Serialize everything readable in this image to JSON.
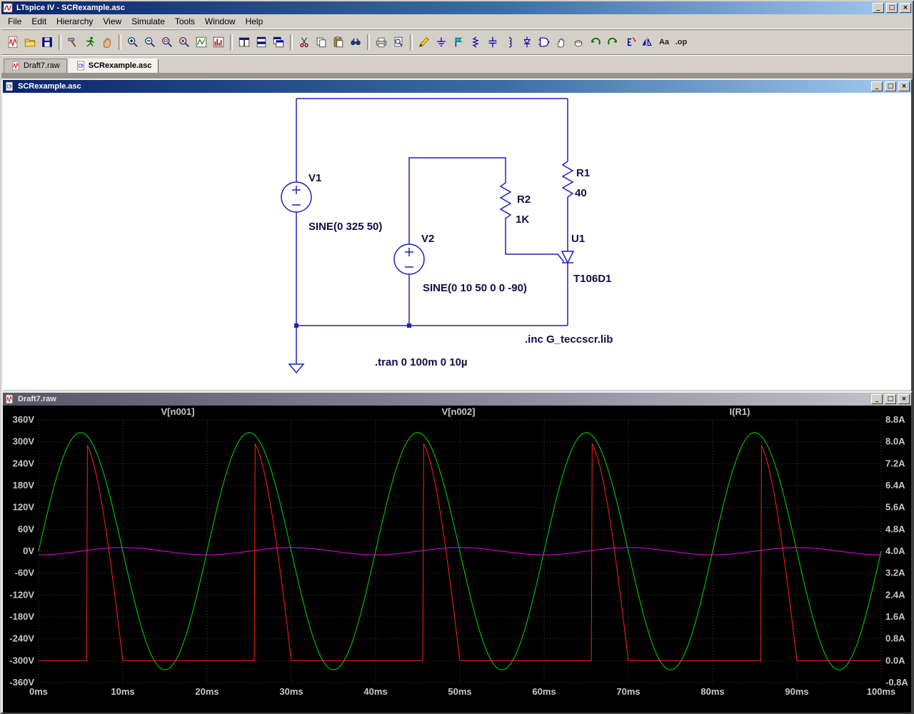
{
  "window": {
    "title": "LTspice IV - SCRexample.asc",
    "controls": {
      "minimize": "_",
      "restore": "□",
      "close": "×"
    }
  },
  "menu": {
    "items": [
      "File",
      "Edit",
      "Hierarchy",
      "View",
      "Simulate",
      "Tools",
      "Window",
      "Help"
    ]
  },
  "toolbar": {
    "buttons": [
      {
        "name": "new-schematic",
        "icon": "doc-wave"
      },
      {
        "name": "open-file",
        "icon": "folder"
      },
      {
        "name": "save",
        "icon": "save"
      },
      {
        "sep": true
      },
      {
        "name": "control-panel",
        "icon": "hammer"
      },
      {
        "name": "run-simulation",
        "icon": "run"
      },
      {
        "name": "halt-simulation",
        "icon": "halt"
      },
      {
        "sep": true
      },
      {
        "name": "zoom-in",
        "icon": "zoom-in"
      },
      {
        "name": "zoom-out",
        "icon": "zoom-out"
      },
      {
        "name": "zoom-area",
        "icon": "zoom-area"
      },
      {
        "name": "zoom-full-extents",
        "icon": "zoom-extents"
      },
      {
        "name": "autorange-y",
        "icon": "plot-line"
      },
      {
        "name": "fft",
        "icon": "plot-bars"
      },
      {
        "sep": true
      },
      {
        "name": "tile-vertically",
        "icon": "tile-v"
      },
      {
        "name": "tile-horizontally",
        "icon": "tile-h"
      },
      {
        "name": "cascade-windows",
        "icon": "cascade"
      },
      {
        "sep": true
      },
      {
        "name": "cut",
        "icon": "cut"
      },
      {
        "name": "copy",
        "icon": "copy"
      },
      {
        "name": "paste",
        "icon": "paste"
      },
      {
        "name": "find",
        "icon": "find"
      },
      {
        "sep": true
      },
      {
        "name": "print",
        "icon": "print"
      },
      {
        "name": "print-preview",
        "icon": "print-preview"
      },
      {
        "sep": true
      },
      {
        "name": "wire",
        "icon": "pencil"
      },
      {
        "name": "ground",
        "icon": "ground"
      },
      {
        "name": "net-label",
        "icon": "flag"
      },
      {
        "name": "resistor",
        "icon": "resistor"
      },
      {
        "name": "capacitor",
        "icon": "capacitor"
      },
      {
        "name": "inductor",
        "icon": "inductor"
      },
      {
        "name": "diode",
        "icon": "diode"
      },
      {
        "name": "component",
        "icon": "gate"
      },
      {
        "name": "move",
        "icon": "hand-open"
      },
      {
        "name": "drag",
        "icon": "hand-grab"
      },
      {
        "name": "undo",
        "icon": "undo"
      },
      {
        "name": "redo",
        "icon": "redo"
      },
      {
        "name": "rotate",
        "icon": "rotate"
      },
      {
        "name": "mirror",
        "icon": "mirror"
      },
      {
        "name": "text",
        "text": "Aa"
      },
      {
        "name": "spice-directive",
        "text": ".op"
      }
    ]
  },
  "tabs": [
    {
      "label": "Draft7.raw",
      "icon": "doc-wave",
      "active": false
    },
    {
      "label": "SCRexample.asc",
      "icon": "doc-sch",
      "active": true
    }
  ],
  "schematic": {
    "title": "SCRexample.asc",
    "components": {
      "v1": {
        "name": "V1",
        "value": "SINE(0 325 50)"
      },
      "v2": {
        "name": "V2",
        "value": "SINE(0 10 50 0 0 -90)"
      },
      "r1": {
        "name": "R1",
        "value": "40"
      },
      "r2": {
        "name": "R2",
        "value": "1K"
      },
      "u1": {
        "name": "U1",
        "value": "T106D1"
      }
    },
    "directives": {
      "include": ".inc G_teccscr.lib",
      "tran": ".tran 0 100m 0 10µ"
    }
  },
  "waveform": {
    "title": "Draft7.raw"
  },
  "chart_data": {
    "type": "line",
    "title": "",
    "background": "#000000",
    "grid": true,
    "legend_position": "top",
    "x": {
      "unit": "ms",
      "range": [
        0,
        100
      ],
      "tick_step": 10,
      "ticks": [
        "0ms",
        "10ms",
        "20ms",
        "30ms",
        "40ms",
        "50ms",
        "60ms",
        "70ms",
        "80ms",
        "90ms",
        "100ms"
      ]
    },
    "y_left": {
      "unit": "V",
      "range": [
        -360,
        360
      ],
      "tick_step": 60,
      "ticks": [
        "360V",
        "300V",
        "240V",
        "180V",
        "120V",
        "60V",
        "0V",
        "-60V",
        "-120V",
        "-180V",
        "-240V",
        "-300V",
        "-360V"
      ]
    },
    "y_right": {
      "unit": "A",
      "range": [
        -0.8,
        8.8
      ],
      "tick_step": 0.8,
      "ticks": [
        "8.8A",
        "8.0A",
        "7.2A",
        "6.4A",
        "5.6A",
        "4.8A",
        "4.0A",
        "3.2A",
        "2.4A",
        "1.6A",
        "0.8A",
        "0.0A",
        "-0.8A"
      ]
    },
    "series": [
      {
        "name": "V[n001]",
        "color": "#00dc00",
        "axis": "left",
        "model": "sine",
        "amplitude": 325,
        "frequency_hz": 50,
        "phase_deg": 0
      },
      {
        "name": "V[n002]",
        "color": "#e800e8",
        "axis": "left",
        "model": "sine",
        "amplitude": 10,
        "frequency_hz": 50,
        "phase_deg": -90
      },
      {
        "name": "I(R1)",
        "color": "#ff2020",
        "axis": "right",
        "model": "scr",
        "peak": 8.125,
        "frequency_hz": 50,
        "fire_ms": 5.7,
        "extinguish_ms": 10
      }
    ]
  }
}
